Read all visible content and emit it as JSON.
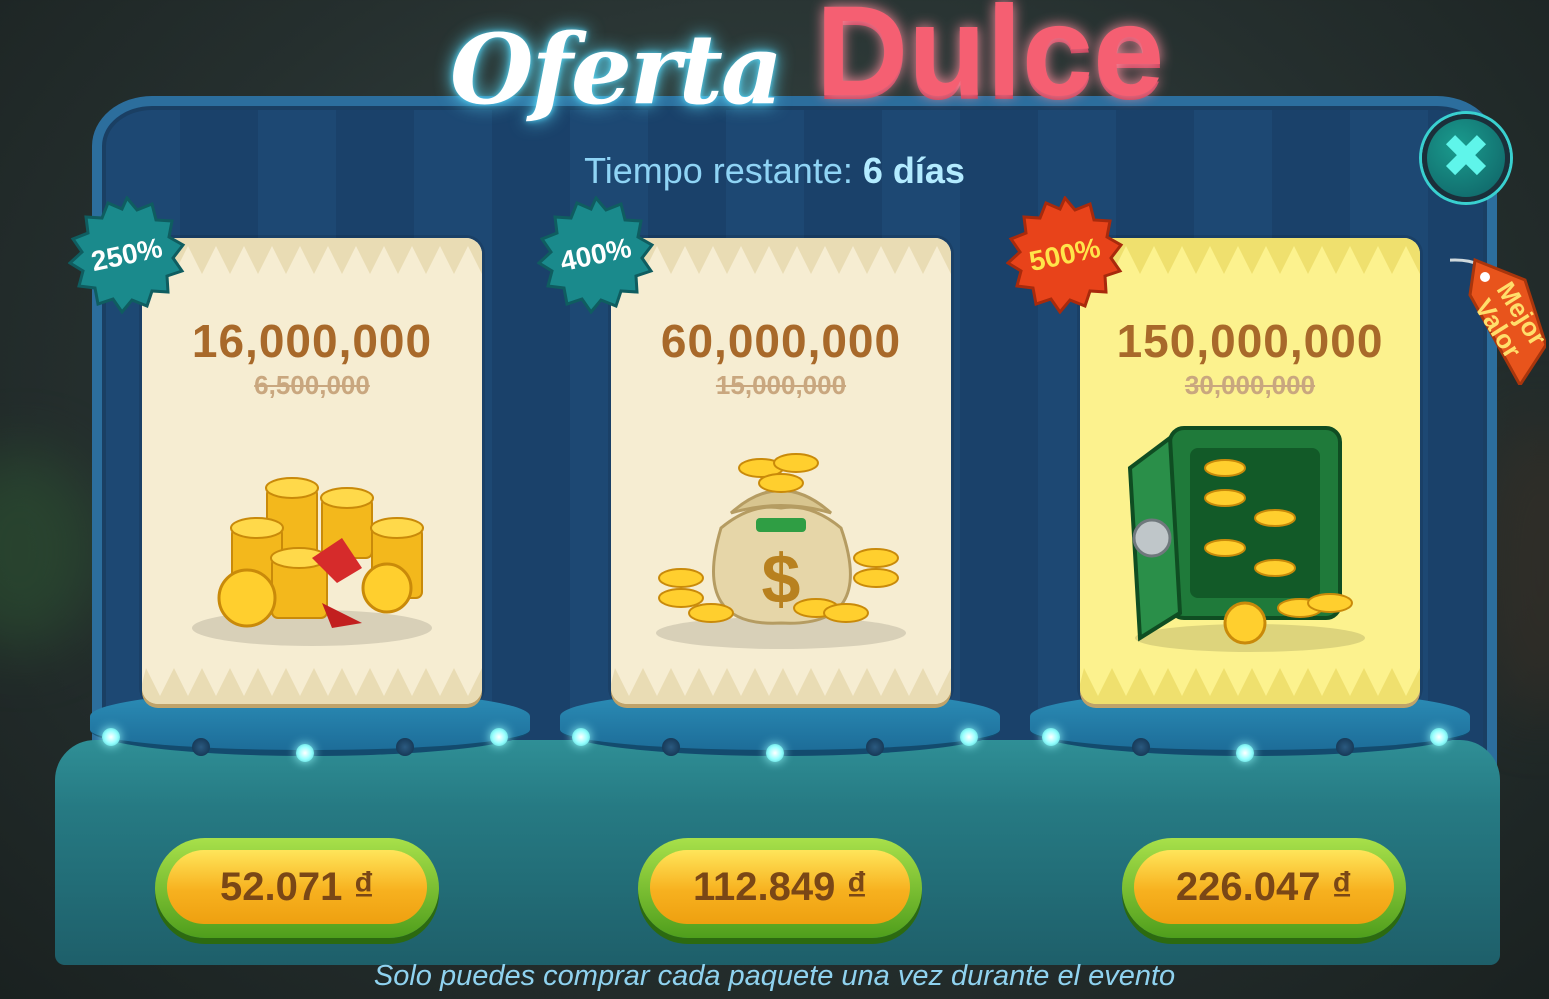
{
  "title": {
    "part1": "Oferta",
    "part2": "Dulce"
  },
  "timer": {
    "label": "Tiempo restante:",
    "value": "6 días"
  },
  "close": {
    "icon": "close-icon",
    "glyph": "✖"
  },
  "best_tag": "Mejor Valor",
  "packages": [
    {
      "bonus": "250%",
      "amount": "16,000,000",
      "old": "6,500,000",
      "price": "52.071 ₫",
      "badge_color": "#1a8a8c",
      "art": "coin-stacks-gift-icon"
    },
    {
      "bonus": "400%",
      "amount": "60,000,000",
      "old": "15,000,000",
      "price": "112.849 ₫",
      "badge_color": "#1a8a8c",
      "art": "money-bag-icon"
    },
    {
      "bonus": "500%",
      "amount": "150,000,000",
      "old": "30,000,000",
      "price": "226.047 ₫",
      "badge_color": "#e8431a",
      "art": "safe-icon"
    }
  ],
  "footer": "Solo puedes comprar cada paquete una vez durante el evento"
}
